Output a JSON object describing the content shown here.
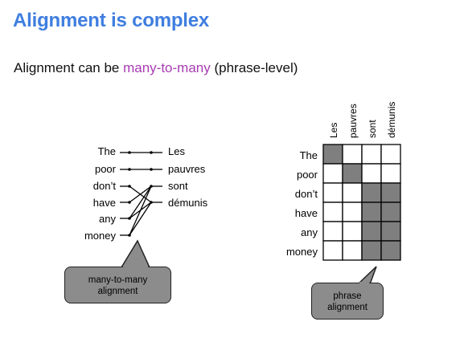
{
  "slide": {
    "title": "Alignment is complex",
    "subtitle_prefix": "Alignment can be ",
    "subtitle_highlight": "many-to-many",
    "subtitle_suffix": " (phrase-level)",
    "highlight_color": "#a83bb3",
    "title_color": "#3f7ee0"
  },
  "left_diagram": {
    "source_words": [
      "The",
      "poor",
      "don’t",
      "have",
      "any",
      "money"
    ],
    "target_words": [
      "Les",
      "pauvres",
      "sont",
      "démunis"
    ],
    "callout": [
      "many-to-many",
      "alignment"
    ]
  },
  "right_diagram": {
    "row_labels": [
      "The",
      "poor",
      "don’t",
      "have",
      "any",
      "money"
    ],
    "column_labels": [
      "Les",
      "pauvres",
      "sont",
      "démunis"
    ],
    "filled_cells": [
      [
        0,
        0
      ],
      [
        1,
        1
      ],
      [
        2,
        2
      ],
      [
        2,
        3
      ],
      [
        3,
        2
      ],
      [
        3,
        3
      ],
      [
        4,
        2
      ],
      [
        4,
        3
      ],
      [
        5,
        2
      ],
      [
        5,
        3
      ]
    ],
    "callout": [
      "phrase",
      "alignment"
    ],
    "fill_color": "#7f7f7f"
  }
}
